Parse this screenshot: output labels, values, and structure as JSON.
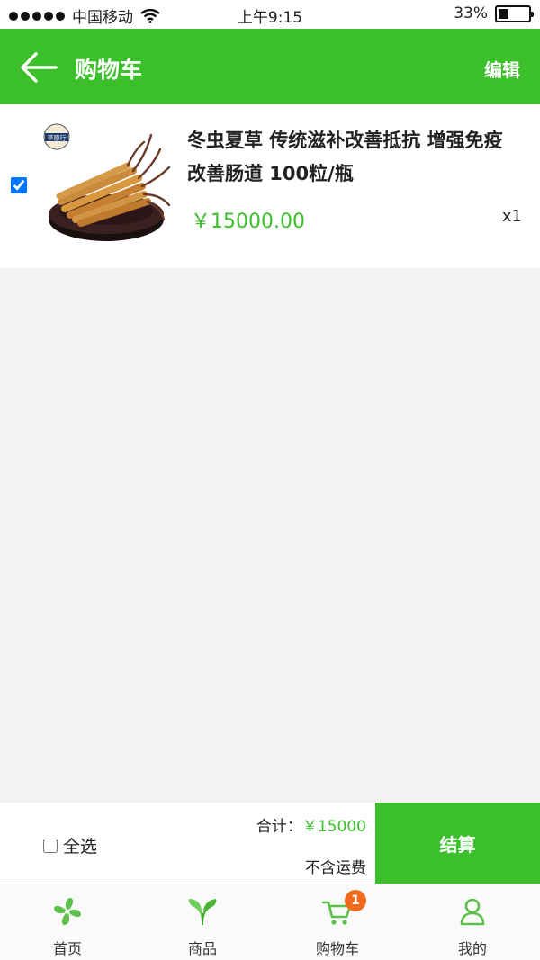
{
  "status_bar": {
    "carrier": "中国移动",
    "time": "上午9:15",
    "battery_percent": "33%",
    "battery_level": 0.33
  },
  "header": {
    "title": "购物车",
    "edit_label": "编辑"
  },
  "cart": {
    "items": [
      {
        "checked": true,
        "brand_mark": "草原行",
        "name": "冬虫夏草 传统滋补改善抵抗 增强免疫 改善肠道 100粒/瓶",
        "price": "￥15000.00",
        "quantity": "x1"
      }
    ]
  },
  "settle": {
    "select_all_label": "全选",
    "total_label": "合计：",
    "total_amount": "￥15000",
    "shipping_note": "不含运费",
    "checkout_label": "结算"
  },
  "tabs": [
    {
      "label": "首页",
      "icon": "pinwheel-icon"
    },
    {
      "label": "商品",
      "icon": "sprout-icon"
    },
    {
      "label": "购物车",
      "icon": "cart-icon",
      "badge": "1"
    },
    {
      "label": "我的",
      "icon": "user-icon"
    }
  ],
  "colors": {
    "accent": "#3bbf2a",
    "badge": "#f26b1d",
    "background": "#f2f2f2"
  }
}
